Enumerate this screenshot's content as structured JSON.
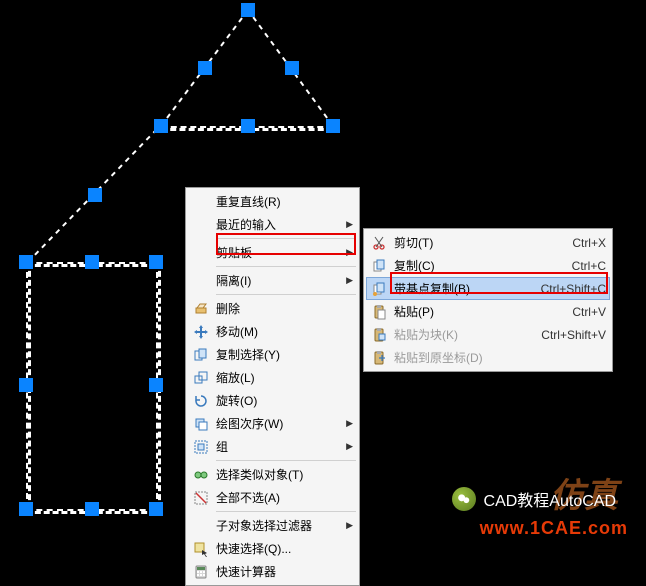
{
  "colors": {
    "grip": "#0a84ff",
    "highlight": "#e60000"
  },
  "faint_bg_text": "AE.C",
  "menu": {
    "items": [
      {
        "label": "重复直线(R)"
      },
      {
        "label": "最近的输入",
        "has_sub": true
      },
      {
        "sep": true
      },
      {
        "label": "剪贴板",
        "has_sub": true,
        "highlighted": true
      },
      {
        "sep": true
      },
      {
        "label": "隔离(I)",
        "has_sub": true
      },
      {
        "sep": true
      },
      {
        "icon": "erase-icon",
        "label": "删除"
      },
      {
        "icon": "move-icon",
        "label": "移动(M)"
      },
      {
        "icon": "copy-icon",
        "label": "复制选择(Y)"
      },
      {
        "icon": "scale-icon",
        "label": "缩放(L)"
      },
      {
        "icon": "rotate-icon",
        "label": "旋转(O)"
      },
      {
        "icon": "draworder-icon",
        "label": "绘图次序(W)",
        "has_sub": true
      },
      {
        "icon": "group-icon",
        "label": "组",
        "has_sub": true
      },
      {
        "sep": true
      },
      {
        "icon": "selectsimilar-icon",
        "label": "选择类似对象(T)"
      },
      {
        "icon": "deselect-icon",
        "label": "全部不选(A)"
      },
      {
        "sep": true
      },
      {
        "label": "子对象选择过滤器",
        "has_sub": true
      },
      {
        "icon": "quickselect-icon",
        "label": "快速选择(Q)..."
      },
      {
        "icon": "calc-icon",
        "label": "快速计算器"
      }
    ]
  },
  "submenu": {
    "items": [
      {
        "icon": "cut-icon",
        "label": "剪切(T)",
        "shortcut": "Ctrl+X"
      },
      {
        "icon": "copy-clip-icon",
        "label": "复制(C)",
        "shortcut": "Ctrl+C"
      },
      {
        "icon": "copy-base-icon",
        "label": "带基点复制(B)",
        "shortcut": "Ctrl+Shift+C",
        "highlighted": true,
        "hover": true
      },
      {
        "icon": "paste-icon",
        "label": "粘贴(P)",
        "shortcut": "Ctrl+V"
      },
      {
        "icon": "paste-block-icon",
        "label": "粘贴为块(K)",
        "shortcut": "Ctrl+Shift+V",
        "disabled": true
      },
      {
        "icon": "paste-orig-icon",
        "label": "粘贴到原坐标(D)",
        "disabled": true
      }
    ]
  },
  "watermarks": {
    "cad_text": "CAD教程AutoCAD",
    "site": "www.1CAE.com",
    "ghost": "仿真"
  }
}
